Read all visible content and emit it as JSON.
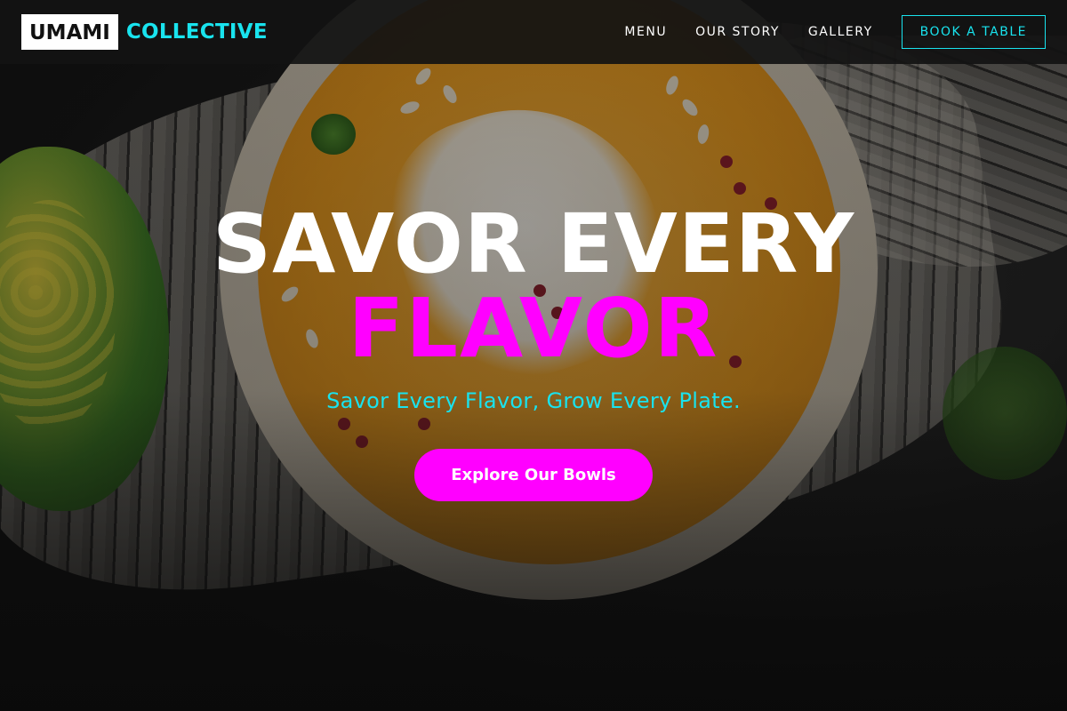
{
  "brand": {
    "logo_box": "UMAMI",
    "logo_text": "COLLECTIVE"
  },
  "nav": {
    "links": [
      "MENU",
      "OUR STORY",
      "GALLERY"
    ],
    "cta": "BOOK A TABLE"
  },
  "hero": {
    "headline_line1": "SAVOR EVERY",
    "headline_line2": "FLAVOR",
    "tagline": "Savor Every Flavor, Grow Every Plate.",
    "button": "Explore Our Bowls",
    "background_image": "soup-bowl-photo"
  },
  "colors": {
    "accent_cyan": "#19e3ee",
    "accent_magenta": "#ff00ff",
    "navbar_bg": "#121212"
  }
}
